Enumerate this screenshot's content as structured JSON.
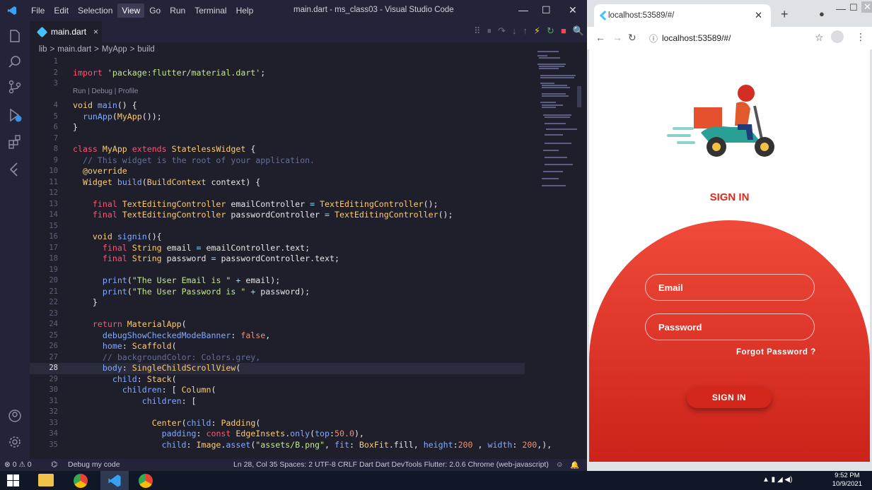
{
  "vscode": {
    "menu": [
      "File",
      "Edit",
      "Selection",
      "View",
      "Go",
      "Run",
      "Terminal",
      "Help"
    ],
    "active_menu": "View",
    "window_title": "main.dart - ms_class03 - Visual Studio Code",
    "tab": {
      "label": "main.dart",
      "close": "×"
    },
    "breadcrumb": [
      "lib",
      ">",
      "main.dart",
      ">",
      "MyApp",
      ">",
      "build"
    ],
    "codelens": "Run | Debug | Profile",
    "lines": [
      {
        "n": "1",
        "html": ""
      },
      {
        "n": "2",
        "html": "<span class='k'>import</span> <span class='s'>'package:flutter/material.dart'</span>;"
      },
      {
        "n": "3",
        "html": ""
      },
      {
        "n": "4",
        "html": "<span class='t'>void</span> <span class='f'>main</span>() {"
      },
      {
        "n": "5",
        "html": "  <span class='f'>runApp</span>(<span class='t'>MyApp</span>());"
      },
      {
        "n": "6",
        "html": "}"
      },
      {
        "n": "7",
        "html": ""
      },
      {
        "n": "8",
        "html": "<span class='k'>class</span> <span class='t'>MyApp</span> <span class='k'>extends</span> <span class='t'>StatelessWidget</span> {"
      },
      {
        "n": "9",
        "html": "  <span class='c'>// This widget is the root of your application.</span>"
      },
      {
        "n": "10",
        "html": "  <span class='t'>@override</span>"
      },
      {
        "n": "11",
        "html": "  <span class='t'>Widget</span> <span class='f'>build</span>(<span class='t'>BuildContext</span> context) {"
      },
      {
        "n": "12",
        "html": ""
      },
      {
        "n": "13",
        "html": "    <span class='k'>final</span> <span class='t'>TextEditingController</span> emailController <span class='p'>=</span> <span class='t'>TextEditingController</span>();"
      },
      {
        "n": "14",
        "html": "    <span class='k'>final</span> <span class='t'>TextEditingController</span> passwordController <span class='p'>=</span> <span class='t'>TextEditingController</span>();"
      },
      {
        "n": "15",
        "html": ""
      },
      {
        "n": "16",
        "html": "    <span class='t'>void</span> <span class='f'>signin</span>(){"
      },
      {
        "n": "17",
        "html": "      <span class='k'>final</span> <span class='t'>String</span> email <span class='p'>=</span> emailController.text;"
      },
      {
        "n": "18",
        "html": "      <span class='k'>final</span> <span class='t'>String</span> password <span class='p'>=</span> passwordController.text;"
      },
      {
        "n": "19",
        "html": ""
      },
      {
        "n": "20",
        "html": "      <span class='f'>print</span>(<span class='s'>\"The User Email is \"</span> <span class='p'>+</span> email);"
      },
      {
        "n": "21",
        "html": "      <span class='f'>print</span>(<span class='s'>\"The User Password is \"</span> <span class='p'>+</span> password);"
      },
      {
        "n": "22",
        "html": "    }"
      },
      {
        "n": "23",
        "html": ""
      },
      {
        "n": "24",
        "html": "    <span class='k'>return</span> <span class='t'>MaterialApp</span>("
      },
      {
        "n": "25",
        "html": "      <span class='pr'>debugShowCheckedModeBanner</span>: <span class='n'>false</span>,"
      },
      {
        "n": "26",
        "html": "      <span class='pr'>home</span>: <span class='t'>Scaffold</span>("
      },
      {
        "n": "27",
        "html": "      <span class='c'>// backgroundColor: Colors.grey,</span>"
      },
      {
        "n": "28",
        "html": "      <span class='pr'>body</span>: <span class='t'>SingleChildScrollView</span>("
      },
      {
        "n": "29",
        "html": "        <span class='pr'>child</span>: <span class='t'>Stack</span>("
      },
      {
        "n": "30",
        "html": "          <span class='pr'>children</span>: [ <span class='t'>Column</span>("
      },
      {
        "n": "31",
        "html": "              <span class='pr'>children</span>: ["
      },
      {
        "n": "32",
        "html": ""
      },
      {
        "n": "33",
        "html": "                <span class='t'>Center</span>(<span class='pr'>child</span>: <span class='t'>Padding</span>("
      },
      {
        "n": "34",
        "html": "                  <span class='pr'>padding</span>: <span class='k'>const</span> <span class='t'>EdgeInsets</span>.<span class='f'>only</span>(<span class='pr'>top</span>:<span class='n'>50.0</span>),"
      },
      {
        "n": "35",
        "html": "                  <span class='pr'>child</span>: <span class='t'>Image</span>.<span class='f'>asset</span>(<span class='s'>\"assets/B.png\"</span>, <span class='pr'>fit</span>: <span class='t'>BoxFit</span>.fill, <span class='pr'>height</span>:<span class='n'>200</span> , <span class='pr'>width</span>: <span class='n'>200</span>,),"
      }
    ],
    "status": {
      "left": "⊗ 0 ⚠ 0",
      "debug": "Debug my code",
      "right": "Ln 28, Col 35   Spaces: 2   UTF-8   CRLF   Dart   Dart DevTools   Flutter: 2.0.6   Chrome (web-javascript)"
    }
  },
  "browser": {
    "tab_title": "localhost:53589/#/",
    "url": "localhost:53589/#/",
    "page": {
      "title": "SIGN IN",
      "email_label": "Email",
      "password_label": "Password",
      "forgot": "Forgot Password ?",
      "button": "SIGN IN"
    }
  },
  "taskbar": {
    "time": "9:52 PM",
    "date": "10/9/2021"
  },
  "colors": {
    "accent_red": "#e0382b",
    "editor_bg": "#1e1f2b"
  }
}
